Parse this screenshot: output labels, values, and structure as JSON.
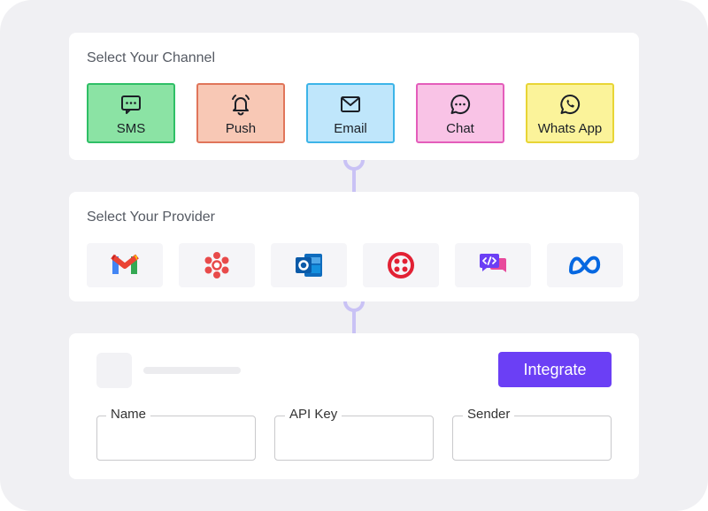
{
  "channel_section": {
    "title": "Select Your Channel",
    "items": [
      {
        "label": "SMS",
        "icon": "sms-icon",
        "bg": "#8be3a4",
        "border": "#2fbf66"
      },
      {
        "label": "Push",
        "icon": "bell-icon",
        "bg": "#f8c8b5",
        "border": "#e0755a"
      },
      {
        "label": "Email",
        "icon": "envelope-icon",
        "bg": "#bfe6fb",
        "border": "#3cb4e8"
      },
      {
        "label": "Chat",
        "icon": "chat-icon",
        "bg": "#f9c3e6",
        "border": "#e45dbb"
      },
      {
        "label": "Whats App",
        "icon": "whatsapp-icon",
        "bg": "#fbf39a",
        "border": "#e8d535"
      }
    ]
  },
  "provider_section": {
    "title": "Select Your Provider",
    "items": [
      {
        "icon": "gmail-icon"
      },
      {
        "icon": "flower-logo-icon"
      },
      {
        "icon": "outlook-icon"
      },
      {
        "icon": "twilio-icon"
      },
      {
        "icon": "code-chat-icon"
      },
      {
        "icon": "meta-icon"
      }
    ]
  },
  "integration_section": {
    "button_label": "Integrate",
    "fields": [
      {
        "label": "Name",
        "value": ""
      },
      {
        "label": "API Key",
        "value": ""
      },
      {
        "label": "Sender",
        "value": ""
      }
    ]
  },
  "colors": {
    "accent": "#6b3ff5",
    "connector": "#c9c2f5"
  }
}
